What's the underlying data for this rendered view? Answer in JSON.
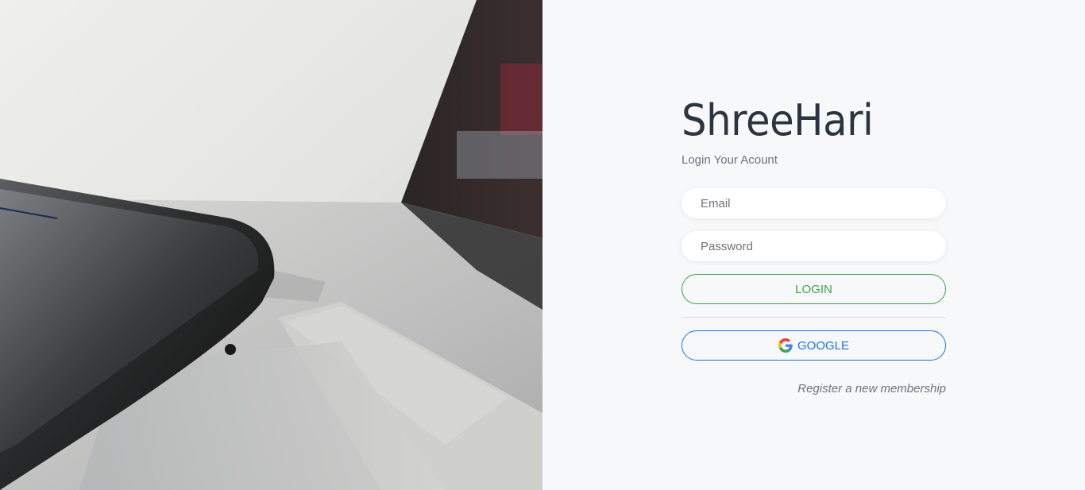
{
  "brand": {
    "title": "ShreeHari"
  },
  "login": {
    "subtitle": "Login Your Acount",
    "email_placeholder": "Email",
    "password_placeholder": "Password",
    "login_label": "LOGIN",
    "google_label": "GOOGLE",
    "register_link": "Register a new membership"
  },
  "colors": {
    "login_accent": "#3aa845",
    "google_accent": "#1a73e8",
    "panel_bg": "#f6f8fa"
  },
  "icons": {
    "google": "google-g-icon"
  }
}
